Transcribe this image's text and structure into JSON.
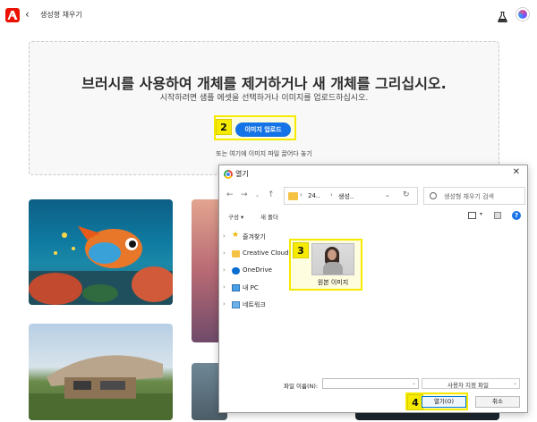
{
  "header": {
    "title": "생성형 채우기",
    "back_glyph": "‹"
  },
  "dropzone": {
    "title": "브러시를 사용하여 개체를 제거하거나 새 개체를 그리십시오.",
    "subtitle": "시작하려면 샘플 에셋을 선택하거나 이미지를 업로드하십시오.",
    "upload_label": "이미지 업로드",
    "drop_hint": "또는 여기에 이미지 파일 끌어다 놓기",
    "marker": "2"
  },
  "dialog": {
    "title": "열기",
    "close_glyph": "✕",
    "address": {
      "seg1": "24..",
      "seg2": "생성..",
      "sep": "›"
    },
    "search_placeholder": "생성형 채우기 검색",
    "toolbar": {
      "organize": "구성 ▾",
      "new_folder": "새 폴더",
      "help": "?"
    },
    "nav_items": [
      {
        "label": "즐겨찾기",
        "icon": "star-icon"
      },
      {
        "label": "Creative Cloud",
        "icon": "folder-icon"
      },
      {
        "label": "OneDrive",
        "icon": "cloud-icon"
      },
      {
        "label": "내 PC",
        "icon": "pc-icon"
      },
      {
        "label": "네트워크",
        "icon": "network-icon"
      }
    ],
    "file": {
      "label": "원본 이미지",
      "marker": "3"
    },
    "filename_label": "파일 이름(N):",
    "filetype_label": "사용자 지정 파일",
    "open_label": "열기(O)",
    "cancel_label": "취소",
    "open_marker": "4"
  },
  "colors": {
    "accent": "#1473e6",
    "highlight": "#f5ea00",
    "brand": "#eb1000"
  }
}
